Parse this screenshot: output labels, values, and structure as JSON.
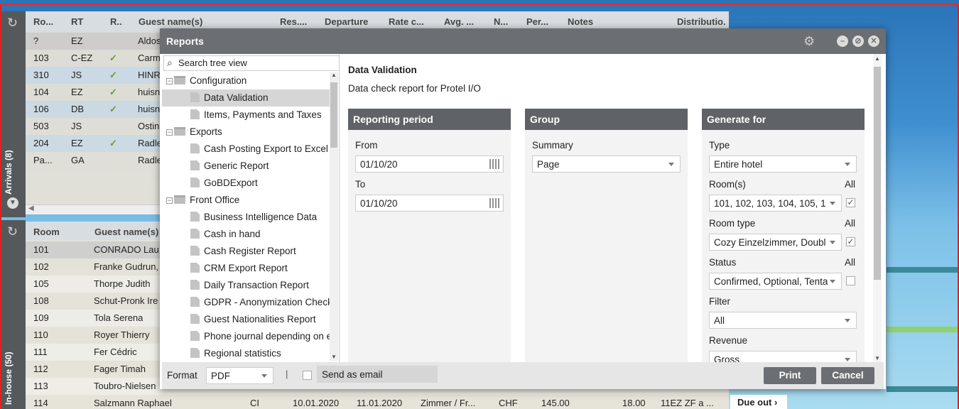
{
  "arrivals": {
    "bar_label": "Arrivals (8)",
    "columns": [
      "Ro...",
      "RT",
      "R..",
      "Guest name(s)",
      "Res....",
      "Departure",
      "Rate c...",
      "Avg. ...",
      "N...",
      "Per...",
      "Notes",
      "Distributio."
    ],
    "rows": [
      {
        "room": "?",
        "rt": "EZ",
        "status": "",
        "name": "Aldos"
      },
      {
        "room": "103",
        "rt": "C-EZ",
        "status": "check",
        "name": "Carm"
      },
      {
        "room": "310",
        "rt": "JS",
        "status": "check",
        "name": "HINR"
      },
      {
        "room": "104",
        "rt": "EZ",
        "status": "check",
        "name": "huisn"
      },
      {
        "room": "106",
        "rt": "DB",
        "status": "check",
        "name": "huisn"
      },
      {
        "room": "503",
        "rt": "JS",
        "status": "red-dot",
        "name": "Ostin"
      },
      {
        "room": "204",
        "rt": "EZ",
        "status": "check",
        "name": "Radle"
      },
      {
        "room": "Pa...",
        "rt": "GA",
        "status": "green-dot",
        "name": "Radle"
      }
    ]
  },
  "inhouse": {
    "bar_label": "In-house (50)",
    "columns": [
      "Room",
      "Guest name(s)"
    ],
    "rows": [
      {
        "room": "101",
        "name": "CONRADO Lau"
      },
      {
        "room": "102",
        "name": "Franke Gudrun,"
      },
      {
        "room": "105",
        "name": "Thorpe Judith"
      },
      {
        "room": "108",
        "name": "Schut-Pronk Ire"
      },
      {
        "room": "109",
        "name": "Tola Serena"
      },
      {
        "room": "110",
        "name": "Royer Thierry"
      },
      {
        "room": "111",
        "name": "Fer Cédric"
      },
      {
        "room": "112",
        "name": "Fager Timah"
      },
      {
        "room": "113",
        "name": "Toubro-Nielsen"
      },
      {
        "room": "114",
        "name": "Salzmann Raphael",
        "status": "CI",
        "arrival": "10.01.2020",
        "departure": "11.01.2020",
        "rate": "Zimmer / Fr...",
        "currency": "CHF",
        "amount": "145.00",
        "per": "18.00",
        "notes": "11EZ ZF a ..."
      }
    ],
    "due_out_label": "Due out"
  },
  "dialog": {
    "title": "Reports",
    "search_placeholder": "Search tree view",
    "tree": {
      "config_folder": "Configuration",
      "config_items": [
        "Data Validation",
        "Items, Payments and Taxes"
      ],
      "exports_folder": "Exports",
      "exports_items": [
        "Cash Posting Export to Excel",
        "Generic Report",
        "GoBDExport"
      ],
      "fo_folder": "Front Office",
      "fo_items": [
        "Business Intelligence Data",
        "Cash in hand",
        "Cash Register Report",
        "CRM Export Report",
        "Daily Transaction Report",
        "GDPR - Anonymization Check",
        "Guest Nationalities Report",
        "Phone journal depending on e",
        "Regional statistics"
      ]
    },
    "report_title": "Data Validation",
    "report_description": "Data check report for Protel I/O",
    "period": {
      "header": "Reporting period",
      "from_label": "From",
      "from_value": "01/10/20",
      "to_label": "To",
      "to_value": "01/10/20"
    },
    "group": {
      "header": "Group",
      "summary_label": "Summary",
      "summary_value": "Page"
    },
    "generate": {
      "header": "Generate for",
      "type_label": "Type",
      "type_value": "Entire hotel",
      "rooms_label": "Room(s)",
      "rooms_value": "101, 102, 103, 104, 105, 1",
      "rooms_all": "All",
      "rooms_all_checked": true,
      "roomtype_label": "Room type",
      "roomtype_value": "Cozy Einzelzimmer, Doubl",
      "roomtype_all": "All",
      "roomtype_all_checked": true,
      "status_label": "Status",
      "status_value": "Confirmed, Optional, Tenta",
      "status_all": "All",
      "status_all_checked": false,
      "filter_label": "Filter",
      "filter_value": "All",
      "revenue_label": "Revenue",
      "revenue_value": "Gross"
    },
    "footer": {
      "format_label": "Format",
      "format_value": "PDF",
      "separator": "|",
      "email_label": "Send as email",
      "email_checked": false,
      "print_label": "Print",
      "cancel_label": "Cancel"
    }
  }
}
